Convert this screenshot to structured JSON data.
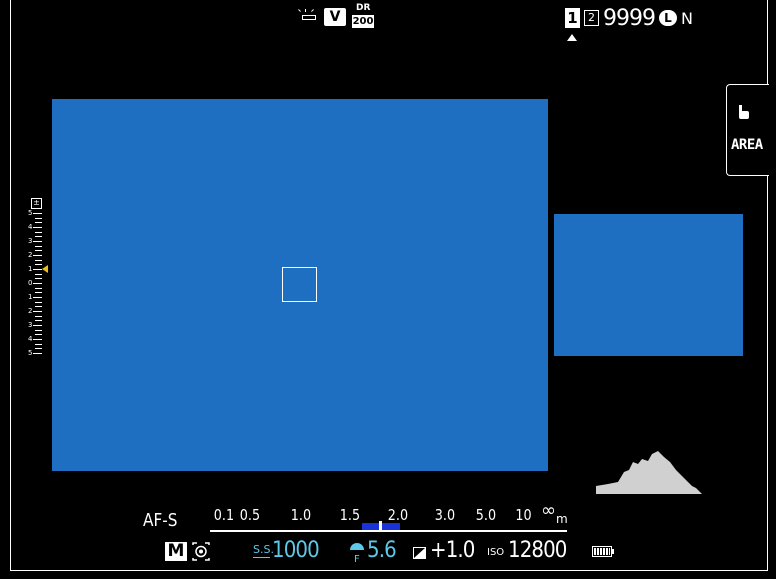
{
  "top_bar": {
    "white_balance_icon": "fluorescent-wb-icon",
    "film_simulation": "V",
    "dynamic_range_label": "DR",
    "dynamic_range_value": "200",
    "card_slot_active": "1",
    "card_slot_secondary": "2",
    "shots_remaining": "9999",
    "image_size": "L",
    "image_quality": "N"
  },
  "area_button": {
    "label": "AREA",
    "icon": "touch-hand-icon"
  },
  "exposure_scale": {
    "numbers": [
      "5",
      "4",
      "3",
      "2",
      "1",
      "0",
      "1",
      "2",
      "3",
      "4",
      "5"
    ],
    "indicator_level": 1
  },
  "focus_scale": {
    "af_mode": "AF-S",
    "distances": [
      "0.1",
      "0.5",
      "1.0",
      "1.5",
      "2.0",
      "3.0",
      "5.0",
      "10"
    ],
    "infinity": "∞",
    "unit": "m"
  },
  "bottom_bar": {
    "mode": "M",
    "metering_icon": "spot-metering-icon",
    "shutter_prefix": "S.S.",
    "shutter_speed": "1000",
    "aperture_prefix": "F",
    "aperture": "5.6",
    "exposure_comp": "+1.0",
    "iso_prefix": "ISO",
    "iso": "12800",
    "battery_icon": "battery-icon"
  },
  "colors": {
    "view_blue": "#1e6fc2",
    "accent_cyan": "#5dc8e8",
    "dof_blue": "#1a33d8",
    "indicator_yellow": "#e8c020",
    "histogram": "#d0d0d0"
  }
}
